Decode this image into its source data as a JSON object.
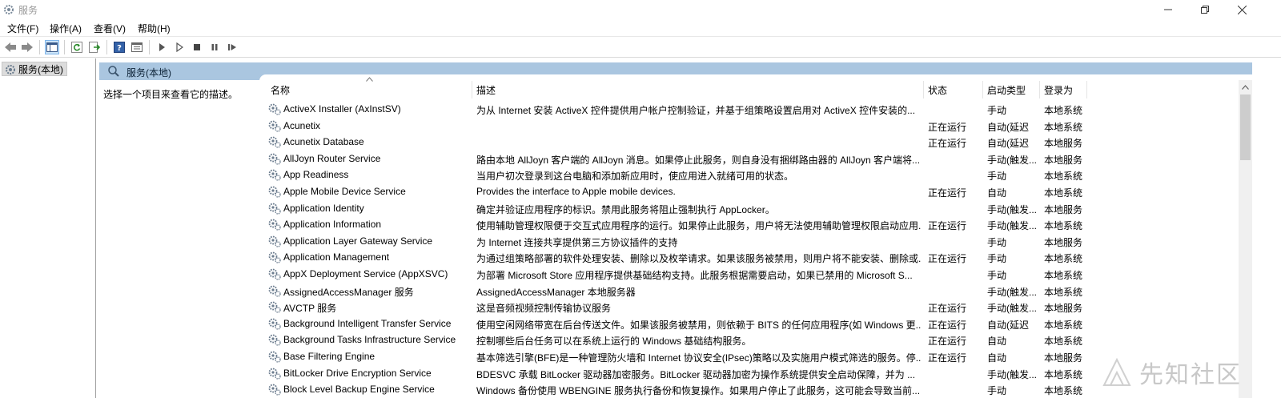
{
  "window": {
    "title": "服务"
  },
  "menu": [
    {
      "label": "文件(F)"
    },
    {
      "label": "操作(A)"
    },
    {
      "label": "查看(V)"
    },
    {
      "label": "帮助(H)"
    }
  ],
  "tree": {
    "root_label": "服务(本地)"
  },
  "panel": {
    "title": "服务(本地)",
    "left_description": "选择一个项目来查看它的描述。"
  },
  "table": {
    "columns": [
      {
        "label": "名称"
      },
      {
        "label": "描述"
      },
      {
        "label": "状态"
      },
      {
        "label": "启动类型"
      },
      {
        "label": "登录为"
      }
    ],
    "rows": [
      {
        "name": "ActiveX Installer (AxInstSV)",
        "desc": "为从 Internet 安装 ActiveX 控件提供用户帐户控制验证，并基于组策略设置启用对 ActiveX 控件安装的...",
        "status": "",
        "startup": "手动",
        "logon": "本地系统"
      },
      {
        "name": "Acunetix",
        "desc": "",
        "status": "正在运行",
        "startup": "自动(延迟",
        "logon": "本地系统"
      },
      {
        "name": "Acunetix Database",
        "desc": "",
        "status": "正在运行",
        "startup": "自动(延迟",
        "logon": "本地服务"
      },
      {
        "name": "AllJoyn Router Service",
        "desc": "路由本地 AllJoyn 客户端的 AllJoyn 消息。如果停止此服务，则自身没有捆绑路由器的 AllJoyn 客户端将...",
        "status": "",
        "startup": "手动(触发...",
        "logon": "本地服务"
      },
      {
        "name": "App Readiness",
        "desc": "当用户初次登录到这台电脑和添加新应用时，使应用进入就绪可用的状态。",
        "status": "",
        "startup": "手动",
        "logon": "本地系统"
      },
      {
        "name": "Apple Mobile Device Service",
        "desc": "Provides the interface to Apple mobile devices.",
        "status": "正在运行",
        "startup": "自动",
        "logon": "本地系统"
      },
      {
        "name": "Application Identity",
        "desc": "确定并验证应用程序的标识。禁用此服务将阻止强制执行 AppLocker。",
        "status": "",
        "startup": "手动(触发...",
        "logon": "本地服务"
      },
      {
        "name": "Application Information",
        "desc": "使用辅助管理权限便于交互式应用程序的运行。如果停止此服务，用户将无法使用辅助管理权限启动应用...",
        "status": "正在运行",
        "startup": "手动(触发...",
        "logon": "本地系统"
      },
      {
        "name": "Application Layer Gateway Service",
        "desc": "为 Internet 连接共享提供第三方协议插件的支持",
        "status": "",
        "startup": "手动",
        "logon": "本地服务"
      },
      {
        "name": "Application Management",
        "desc": "为通过组策略部署的软件处理安装、删除以及枚举请求。如果该服务被禁用，则用户将不能安装、删除或...",
        "status": "正在运行",
        "startup": "手动",
        "logon": "本地系统"
      },
      {
        "name": "AppX Deployment Service (AppXSVC)",
        "desc": "为部署 Microsoft Store 应用程序提供基础结构支持。此服务根据需要启动，如果已禁用的 Microsoft S...",
        "status": "",
        "startup": "手动",
        "logon": "本地系统"
      },
      {
        "name": "AssignedAccessManager 服务",
        "desc": "AssignedAccessManager 本地服务器",
        "status": "",
        "startup": "手动(触发...",
        "logon": "本地系统"
      },
      {
        "name": "AVCTP 服务",
        "desc": "这是音频视频控制传输协议服务",
        "status": "正在运行",
        "startup": "手动(触发...",
        "logon": "本地服务"
      },
      {
        "name": "Background Intelligent Transfer Service",
        "desc": "使用空闲网络带宽在后台传送文件。如果该服务被禁用，则依赖于 BITS 的任何应用程序(如 Windows 更...",
        "status": "正在运行",
        "startup": "自动(延迟",
        "logon": "本地系统"
      },
      {
        "name": "Background Tasks Infrastructure Service",
        "desc": "控制哪些后台任务可以在系统上运行的 Windows 基础结构服务。",
        "status": "正在运行",
        "startup": "自动",
        "logon": "本地系统"
      },
      {
        "name": "Base Filtering Engine",
        "desc": "基本筛选引擎(BFE)是一种管理防火墙和 Internet 协议安全(IPsec)策略以及实施用户模式筛选的服务。停...",
        "status": "正在运行",
        "startup": "自动",
        "logon": "本地服务"
      },
      {
        "name": "BitLocker Drive Encryption Service",
        "desc": "BDESVC 承载 BitLocker 驱动器加密服务。BitLocker 驱动器加密为操作系统提供安全启动保障，并为 ...",
        "status": "",
        "startup": "手动(触发...",
        "logon": "本地系统"
      },
      {
        "name": "Block Level Backup Engine Service",
        "desc": "Windows 备份使用 WBENGINE 服务执行备份和恢复操作。如果用户停止了此服务，这可能会导致当前...",
        "status": "",
        "startup": "手动",
        "logon": "本地系统"
      }
    ]
  },
  "watermark": {
    "text": "先知社区"
  }
}
